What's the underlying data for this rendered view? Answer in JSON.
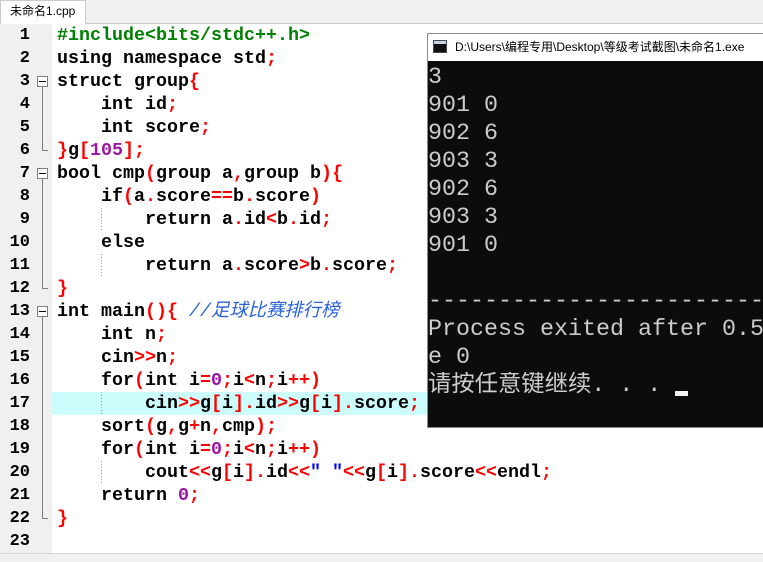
{
  "tab": {
    "label": "未命名1.cpp"
  },
  "editor": {
    "lines": [
      {
        "n": "1",
        "code": "#include<bits/stdc++.h>"
      },
      {
        "n": "2",
        "code": "using namespace std;"
      },
      {
        "n": "3",
        "code": "struct group{"
      },
      {
        "n": "4",
        "code": "    int id;"
      },
      {
        "n": "5",
        "code": "    int score;"
      },
      {
        "n": "6",
        "code": "}g[105];"
      },
      {
        "n": "7",
        "code": "bool cmp(group a,group b){"
      },
      {
        "n": "8",
        "code": "    if(a.score==b.score)"
      },
      {
        "n": "9",
        "code": "        return a.id<b.id;"
      },
      {
        "n": "10",
        "code": "    else"
      },
      {
        "n": "11",
        "code": "        return a.score>b.score;"
      },
      {
        "n": "12",
        "code": "}"
      },
      {
        "n": "13",
        "code": "int main(){ //足球比赛排行榜"
      },
      {
        "n": "14",
        "code": "    int n;"
      },
      {
        "n": "15",
        "code": "    cin>>n;"
      },
      {
        "n": "16",
        "code": "    for(int i=0;i<n;i++)"
      },
      {
        "n": "17",
        "code": "        cin>>g[i].id>>g[i].score;"
      },
      {
        "n": "18",
        "code": "    sort(g,g+n,cmp);"
      },
      {
        "n": "19",
        "code": "    for(int i=0;i<n;i++)"
      },
      {
        "n": "20",
        "code": "        cout<<g[i].id<<\" \"<<g[i].score<<endl;"
      },
      {
        "n": "21",
        "code": "    return 0;"
      },
      {
        "n": "22",
        "code": "}"
      },
      {
        "n": "23",
        "code": ""
      }
    ]
  },
  "console": {
    "title": "D:\\Users\\编程专用\\Desktop\\等级考试截图\\未命名1.exe",
    "lines": [
      "3",
      "901 0",
      "902 6",
      "903 3",
      "902 6",
      "903 3",
      "901 0",
      "",
      "------------------------",
      "Process exited after 0.5",
      "e 0",
      "请按任意键继续. . ."
    ]
  },
  "colors": {
    "identifier": "#000000",
    "symbol": "#ff0000",
    "number": "#9a16a5",
    "preprocessor": "#008000",
    "comment": "#2a62d8",
    "string": "#0000ff",
    "active_line": "#ccfcfc",
    "console_background": "#0c0c0c",
    "console_text": "#cccccc"
  }
}
